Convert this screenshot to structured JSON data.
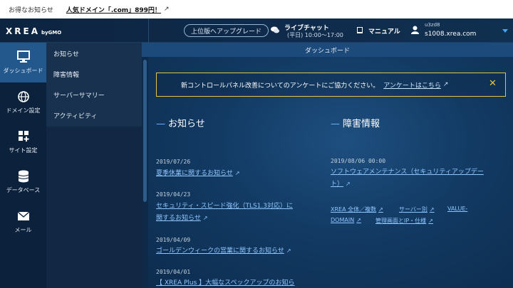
{
  "promo": {
    "label": "お得なお知らせ",
    "link": "人気ドメイン「.com」899円！"
  },
  "header": {
    "logo": "XREA",
    "logo_by": "byGMO",
    "upgrade": "上位版へアップグレード",
    "chat_title": "ライブチャット",
    "chat_hours": "(平日) 10:00～17:00",
    "manual": "マニュアル",
    "user_id": "u3zd8",
    "user_host": "s1008.xrea.com"
  },
  "rail": [
    {
      "label": "ダッシュボード",
      "icon": "monitor-icon"
    },
    {
      "label": "ドメイン設定",
      "icon": "globe-icon"
    },
    {
      "label": "サイト設定",
      "icon": "grid-plus-icon"
    },
    {
      "label": "データベース",
      "icon": "database-icon"
    },
    {
      "label": "メール",
      "icon": "mail-icon"
    }
  ],
  "submenu": [
    "お知らせ",
    "障害情報",
    "サーバーサマリー",
    "アクティビティ"
  ],
  "main": {
    "page_title": "ダッシュボード",
    "notice_text": "新コントロールパネル改善についてのアンケートにご協力ください。",
    "notice_link": "アンケートはこちら",
    "news": {
      "title": "お知らせ",
      "items": [
        {
          "date": "2019/07/26",
          "lines": [
            "夏季休業に関するお知らせ"
          ]
        },
        {
          "date": "2019/04/23",
          "lines": [
            "セキュリティ・スピード強化（TLS1.3対応）に",
            "関するお知らせ"
          ]
        },
        {
          "date": "2019/04/09",
          "lines": [
            "ゴールデンウィークの営業に関するお知らせ"
          ]
        },
        {
          "date": "2019/04/01",
          "lines": [
            "【 XREA Plus 】大幅なスペックアップのお知ら"
          ]
        }
      ]
    },
    "failures": {
      "title": "障害情報",
      "items": [
        {
          "date": "2019/08/06 00:00",
          "lines": [
            "ソフトウェアメンテナンス（セキュリティアップデー",
            "ト）"
          ]
        }
      ],
      "links": [
        "XREA 全体／複数",
        "サーバー別",
        "VALUE-",
        "DOMAIN",
        "管理画面とIP・仕様"
      ]
    }
  },
  "colors": {
    "accent": "#23588c",
    "link": "#8ec6ff",
    "notice_border": "#e3c34a"
  }
}
